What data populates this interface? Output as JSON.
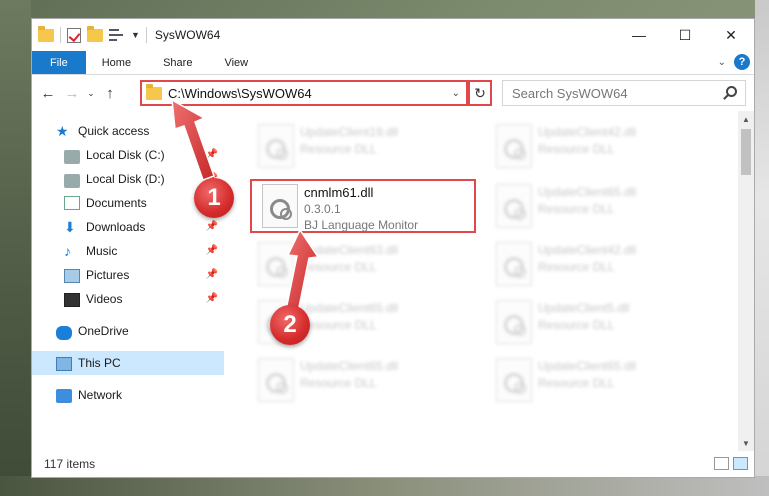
{
  "window": {
    "title": "SysWOW64",
    "controls": {
      "minimize": "—",
      "maximize": "☐",
      "close": "✕"
    }
  },
  "ribbon": {
    "tabs": [
      {
        "label": "File"
      },
      {
        "label": "Home"
      },
      {
        "label": "Share"
      },
      {
        "label": "View"
      }
    ],
    "help": "?"
  },
  "navigation": {
    "back": "←",
    "forward": "→",
    "recent": "⌄",
    "up": "↑",
    "address": "C:\\Windows\\SysWOW64",
    "address_dropdown": "⌄",
    "refresh": "↻",
    "search_placeholder": "Search SysWOW64"
  },
  "sidebar": {
    "quick_access": "Quick access",
    "items": [
      {
        "label": "Local Disk (C:)",
        "pinned": true
      },
      {
        "label": "Local Disk (D:)",
        "pinned": true
      },
      {
        "label": "Documents",
        "pinned": true
      },
      {
        "label": "Downloads",
        "pinned": true
      },
      {
        "label": "Music",
        "pinned": true
      },
      {
        "label": "Pictures",
        "pinned": true
      },
      {
        "label": "Videos",
        "pinned": true
      }
    ],
    "onedrive": "OneDrive",
    "this_pc": "This PC",
    "network": "Network"
  },
  "files": {
    "highlighted": {
      "name": "cnmlm61.dll",
      "version": "0.3.0.1",
      "description": "BJ Language Monitor"
    },
    "blurred": [
      {
        "name": "UpdateClient19.dll",
        "desc": "Resource DLL"
      },
      {
        "name": "UpdateClient42.dll",
        "desc": "Resource DLL"
      },
      {
        "name": "UpdateClient65.dll",
        "desc": "Resource DLL"
      },
      {
        "name": "UpdateClient63.dll",
        "desc": "Resource DLL"
      },
      {
        "name": "UpdateClient42.dll",
        "desc": "Resource DLL"
      },
      {
        "name": "UpdateClient65.dll",
        "desc": "Resource DLL"
      },
      {
        "name": "UpdateClient5.dll",
        "desc": "Resource DLL"
      },
      {
        "name": "UpdateClient65.dll",
        "desc": "Resource DLL"
      },
      {
        "name": "UpdateClient65.dll",
        "desc": "Resource DLL"
      }
    ]
  },
  "status": {
    "item_count": "117 items"
  },
  "annotations": {
    "step1": "1",
    "step2": "2",
    "accent_color": "#e0484c"
  }
}
